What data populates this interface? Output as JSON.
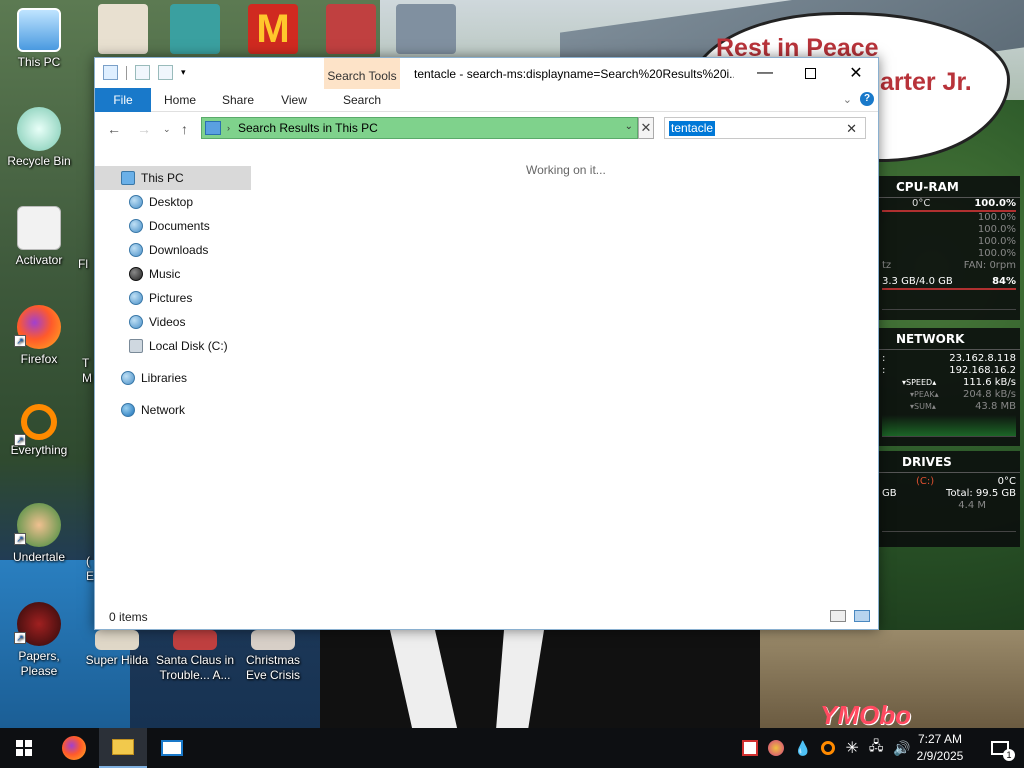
{
  "desktop": {
    "icons_left": [
      {
        "label": "This PC",
        "color": "#6ab8f0"
      },
      {
        "label": "Recycle Bin",
        "color": "#9ad8c8"
      },
      {
        "label": "Activator",
        "color": "#e8e8e8"
      },
      {
        "label": "Firefox",
        "color": "#ff7a1a"
      },
      {
        "label": "Everything",
        "color": "#ff8a00"
      },
      {
        "label": "Undertale",
        "color": "#3a8a3a"
      },
      {
        "label": "Papers, Please",
        "color": "#8a1a1a"
      }
    ],
    "icons_left_col2_partial": [
      {
        "label": "Fl"
      },
      {
        "label": "T\nM"
      },
      {
        "label": "("
      },
      {
        "label": "E"
      }
    ],
    "icons_bottom": [
      {
        "label": "Super Hilda"
      },
      {
        "label": "Santa Claus in Trouble... A..."
      },
      {
        "label": "Christmas Eve Crisis"
      }
    ],
    "wallpaper_text": {
      "line1": "Rest in Peace",
      "line2": "arter Jr."
    },
    "watermark": "YMObo"
  },
  "widgets": {
    "cpu_ram": {
      "title": "CPU-RAM",
      "temp": "0°C",
      "usage": "100.0%",
      "cores": [
        "100.0%",
        "100.0%",
        "100.0%",
        "100.0%"
      ],
      "freq_partial": "tz",
      "fan": "FAN: 0rpm",
      "ram": "3.3 GB/4.0 GB",
      "ram_pct": "84%"
    },
    "network": {
      "title": "NETWORK",
      "ip1": "23.162.8.118",
      "ip2": "192.168.16.2",
      "speed_label": "SPEED",
      "speed": "111.6 kB/s",
      "peak_label": "PEAK",
      "peak": "204.8 kB/s",
      "sum_label": "SUM",
      "sum": "43.8 MB"
    },
    "drives": {
      "title": "DRIVES",
      "drive": "(C:)",
      "temp": "0°C",
      "gb_partial": "GB",
      "total": "Total: 99.5 GB",
      "io": "4.4 M"
    }
  },
  "explorer": {
    "context_tab": "Search Tools",
    "title": "tentacle - search-ms:displayname=Search%20Results%20i...",
    "ribbon_tabs": [
      "File",
      "Home",
      "Share",
      "View",
      "Search"
    ],
    "address": "Search Results in This PC",
    "search_value": "tentacle",
    "nav": [
      {
        "label": "This PC",
        "type": "pc"
      },
      {
        "label": "Desktop",
        "type": "folder"
      },
      {
        "label": "Documents",
        "type": "folder"
      },
      {
        "label": "Downloads",
        "type": "folder"
      },
      {
        "label": "Music",
        "type": "music"
      },
      {
        "label": "Pictures",
        "type": "folder"
      },
      {
        "label": "Videos",
        "type": "folder"
      },
      {
        "label": "Local Disk (C:)",
        "type": "drive"
      },
      {
        "label": "Libraries",
        "type": "folder"
      },
      {
        "label": "Network",
        "type": "net"
      }
    ],
    "working_text": "Working on it...",
    "status": "0 items"
  },
  "taskbar": {
    "time": "7:27 AM",
    "date": "2/9/2025",
    "notification_count": "1"
  }
}
